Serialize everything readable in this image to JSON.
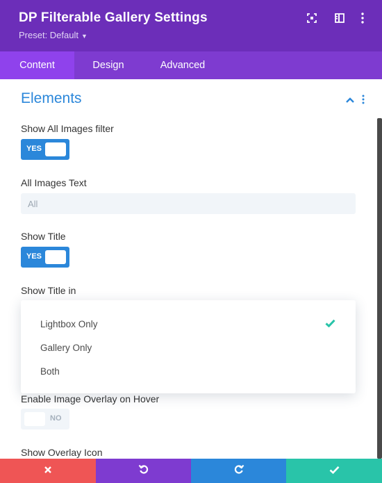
{
  "header": {
    "title": "DP Filterable Gallery Settings",
    "preset": "Preset: Default",
    "icons": [
      "fullscreen-icon",
      "sidebar-toggle-icon",
      "more-vertical-icon"
    ]
  },
  "tabs": [
    {
      "label": "Content",
      "active": true
    },
    {
      "label": "Design",
      "active": false
    },
    {
      "label": "Advanced",
      "active": false
    }
  ],
  "section": {
    "title": "Elements",
    "collapsed": false
  },
  "fields": {
    "show_all_images": {
      "label": "Show All Images filter",
      "toggle_text": "YES",
      "value": true
    },
    "all_images_text": {
      "label": "All Images Text",
      "placeholder": "All",
      "value": ""
    },
    "show_title": {
      "label": "Show Title",
      "toggle_text": "YES",
      "value": true
    },
    "show_title_in": {
      "label": "Show Title in",
      "options": [
        "Lightbox Only",
        "Gallery Only",
        "Both"
      ],
      "selected": "Lightbox Only"
    },
    "enable_overlay": {
      "label": "Enable Image Overlay on Hover",
      "toggle_text": "NO",
      "value": false
    },
    "show_overlay_icon": {
      "label": "Show Overlay Icon"
    }
  },
  "footer": {
    "buttons": [
      {
        "name": "discard",
        "icon": "close-icon",
        "color": "#ef5555"
      },
      {
        "name": "undo",
        "icon": "undo-icon",
        "color": "#7e3bd0"
      },
      {
        "name": "redo",
        "icon": "redo-icon",
        "color": "#2b87da"
      },
      {
        "name": "save",
        "icon": "check-icon",
        "color": "#29c4a9"
      }
    ]
  },
  "colors": {
    "header_bg": "#6c2eb9",
    "tabs_bg": "#7e3bd0",
    "tab_active_bg": "#8f42ec",
    "accent_blue": "#2b87da",
    "check_green": "#29c4a9"
  }
}
